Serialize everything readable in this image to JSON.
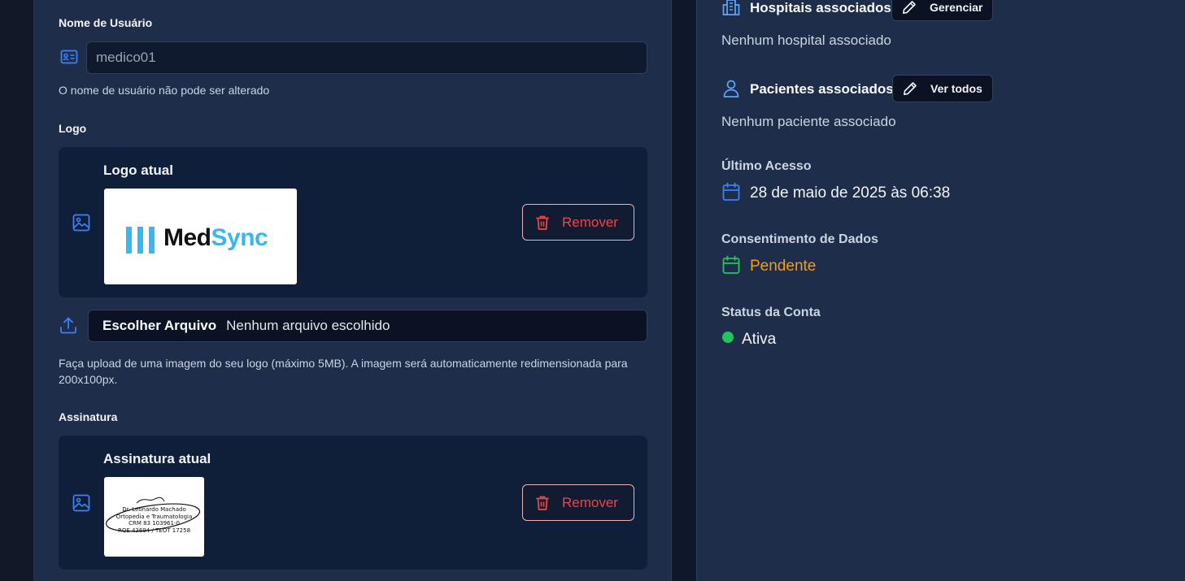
{
  "colors": {
    "accent": "#3b82f6",
    "danger": "#ef4444",
    "warning": "#f59e0b",
    "success": "#22c55e"
  },
  "form": {
    "username": {
      "label": "Nome de Usuário",
      "value": "medico01",
      "hint": "O nome de usuário não pode ser alterado",
      "icon": "id-card-icon"
    },
    "logo": {
      "label": "Logo",
      "card_title": "Logo atual",
      "remove_label": "Remover",
      "logo_brand": "MedSync",
      "file_button": "Escolher Arquivo",
      "file_status": "Nenhum arquivo escolhido",
      "hint": "Faça upload de uma imagem do seu logo (máximo 5MB). A imagem será automaticamente redimensionada para 200x100px."
    },
    "signature": {
      "label": "Assinatura",
      "card_title": "Assinatura atual",
      "remove_label": "Remover",
      "signature_lines": [
        "Dr. Leonardo Machado",
        "Ortopedia e Traumatologia",
        "CRM 83 103961-0",
        "RQE 43694 / TEOT 17258"
      ]
    }
  },
  "side": {
    "hospitals": {
      "title": "Hospitais associados",
      "button": "Gerenciar",
      "empty": "Nenhum hospital associado"
    },
    "patients": {
      "title": "Pacientes associados",
      "button": "Ver todos",
      "empty": "Nenhum paciente associado"
    },
    "last_access": {
      "label": "Último Acesso",
      "value": "28 de maio de 2025 às 06:38"
    },
    "consent": {
      "label": "Consentimento de Dados",
      "value": "Pendente"
    },
    "account_status": {
      "label": "Status da Conta",
      "value": "Ativa"
    }
  }
}
